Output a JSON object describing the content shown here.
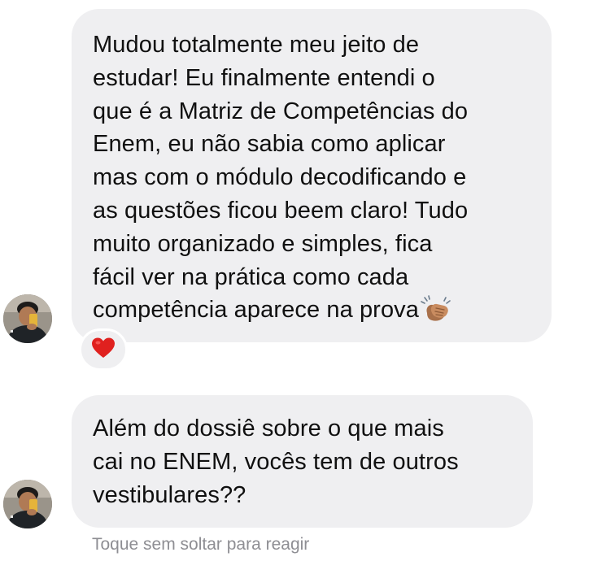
{
  "messages": [
    {
      "lines": [
        "Mudou totalmente meu jeito de",
        "estudar! Eu finalmente entendi o",
        "que é a Matriz de Competências do",
        "Enem, eu não sabia como aplicar",
        "mas com o módulo decodificando e",
        "as questões ficou beem claro! Tudo",
        "muito organizado e simples, fica",
        "fácil ver na prática como cada",
        "competência aparece na prova"
      ],
      "trailing_emoji": "clapping-hands-icon",
      "reaction": "red-heart-icon"
    },
    {
      "lines": [
        "Além do dossiê sobre o que mais",
        "cai no ENEM, vocês tem de outros",
        "vestibulares??"
      ]
    }
  ],
  "hint": "Toque sem soltar para reagir",
  "colors": {
    "bubble": "#efeff1",
    "text": "#101010",
    "hint": "#8e8e93",
    "heart": "#e0211f"
  }
}
